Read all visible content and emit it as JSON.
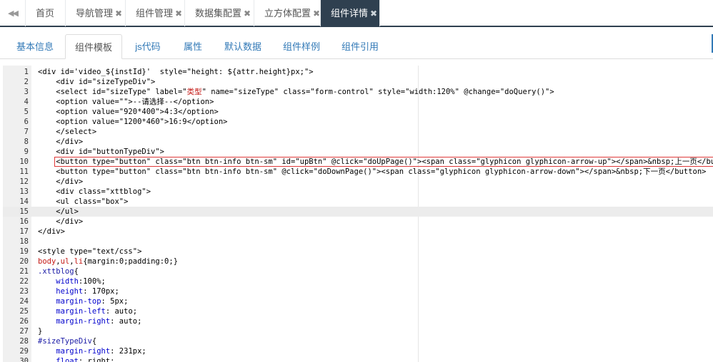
{
  "top_tabs": [
    {
      "label": "首页",
      "closable": false
    },
    {
      "label": "导航管理",
      "closable": true
    },
    {
      "label": "组件管理",
      "closable": true
    },
    {
      "label": "数据集配置",
      "closable": true
    },
    {
      "label": "立方体配置",
      "closable": true
    },
    {
      "label": "组件详情",
      "closable": true,
      "active": true
    }
  ],
  "close_glyph": "✖",
  "back_glyph": "◀◀",
  "sub_tabs": [
    {
      "label": "基本信息"
    },
    {
      "label": "组件模板",
      "active": true
    },
    {
      "label": "js代码"
    },
    {
      "label": "属性"
    },
    {
      "label": "默认数据"
    },
    {
      "label": "组件样例"
    },
    {
      "label": "组件引用"
    }
  ],
  "editor": {
    "active_line": 15,
    "highlighted_line": 10,
    "lines": [
      [
        [
          "t",
          "<div id='video_${instId}'  style=\"height: ${attr.height}px;\">"
        ]
      ],
      [
        [
          "t",
          "    <div id=\"sizeTypeDiv\">"
        ]
      ],
      [
        [
          "t",
          "    <select id=\"sizeType\" label=\""
        ],
        [
          "r",
          "类型"
        ],
        [
          "t",
          "\" name=\"sizeType\" class=\"form-control\" style=\"width:120%\" @change=\"doQuery()\">"
        ]
      ],
      [
        [
          "t",
          "    <option value=\"\">--请选择--</option>"
        ]
      ],
      [
        [
          "t",
          "    <option value=\"920*400\">4:3</option>"
        ]
      ],
      [
        [
          "t",
          "    <option value=\"1200*460\">16:9</option>"
        ]
      ],
      [
        [
          "t",
          "    </select>"
        ]
      ],
      [
        [
          "t",
          "    </div>"
        ]
      ],
      [
        [
          "t",
          "    <div id=\"buttonTypeDiv\">"
        ]
      ],
      [
        [
          "t",
          "    <button type=\"button\" class=\"btn btn-info btn-sm\" id=\"upBtn\" @click=\"doUpPage()\"><span class=\"glyphicon glyphicon-arrow-up\"></span>&nbsp;上一页</button>"
        ]
      ],
      [
        [
          "t",
          "    <button type=\"button\" class=\"btn btn-info btn-sm\" @click=\"doDownPage()\"><span class=\"glyphicon glyphicon-arrow-down\"></span>&nbsp;下一页</button>"
        ]
      ],
      [
        [
          "t",
          "    </div>"
        ]
      ],
      [
        [
          "t",
          "    <div class=\"xttblog\">"
        ]
      ],
      [
        [
          "t",
          "    <ul class=\"box\">"
        ]
      ],
      [
        [
          "t",
          "    </ul>"
        ]
      ],
      [
        [
          "t",
          "    </div>"
        ]
      ],
      [
        [
          "t",
          "</div>"
        ]
      ],
      [
        [
          "t",
          ""
        ]
      ],
      [
        [
          "t",
          "<style type=\"text/css\">"
        ]
      ],
      [
        [
          "r",
          "body"
        ],
        [
          "b",
          ","
        ],
        [
          "r",
          "ul"
        ],
        [
          "b",
          ","
        ],
        [
          "r",
          "li"
        ],
        [
          "b",
          "{margin:0;padding:0;}"
        ]
      ],
      [
        [
          "s",
          ".xttblog"
        ],
        [
          "b",
          "{"
        ]
      ],
      [
        [
          "t",
          "    "
        ],
        [
          "p",
          "width"
        ],
        [
          "b",
          ":100%;"
        ]
      ],
      [
        [
          "t",
          "    "
        ],
        [
          "p",
          "height"
        ],
        [
          "b",
          ": 170px;"
        ]
      ],
      [
        [
          "t",
          "    "
        ],
        [
          "p",
          "margin-top"
        ],
        [
          "b",
          ": 5px;"
        ]
      ],
      [
        [
          "t",
          "    "
        ],
        [
          "p",
          "margin-left"
        ],
        [
          "b",
          ": auto;"
        ]
      ],
      [
        [
          "t",
          "    "
        ],
        [
          "p",
          "margin-right"
        ],
        [
          "b",
          ": auto;"
        ]
      ],
      [
        [
          "b",
          "}"
        ]
      ],
      [
        [
          "s",
          "#sizeTypeDiv"
        ],
        [
          "b",
          "{"
        ]
      ],
      [
        [
          "t",
          "    "
        ],
        [
          "p",
          "margin-right"
        ],
        [
          "b",
          ": 231px;"
        ]
      ],
      [
        [
          "t",
          "    "
        ],
        [
          "p",
          "float"
        ],
        [
          "b",
          ": right;"
        ]
      ]
    ]
  }
}
